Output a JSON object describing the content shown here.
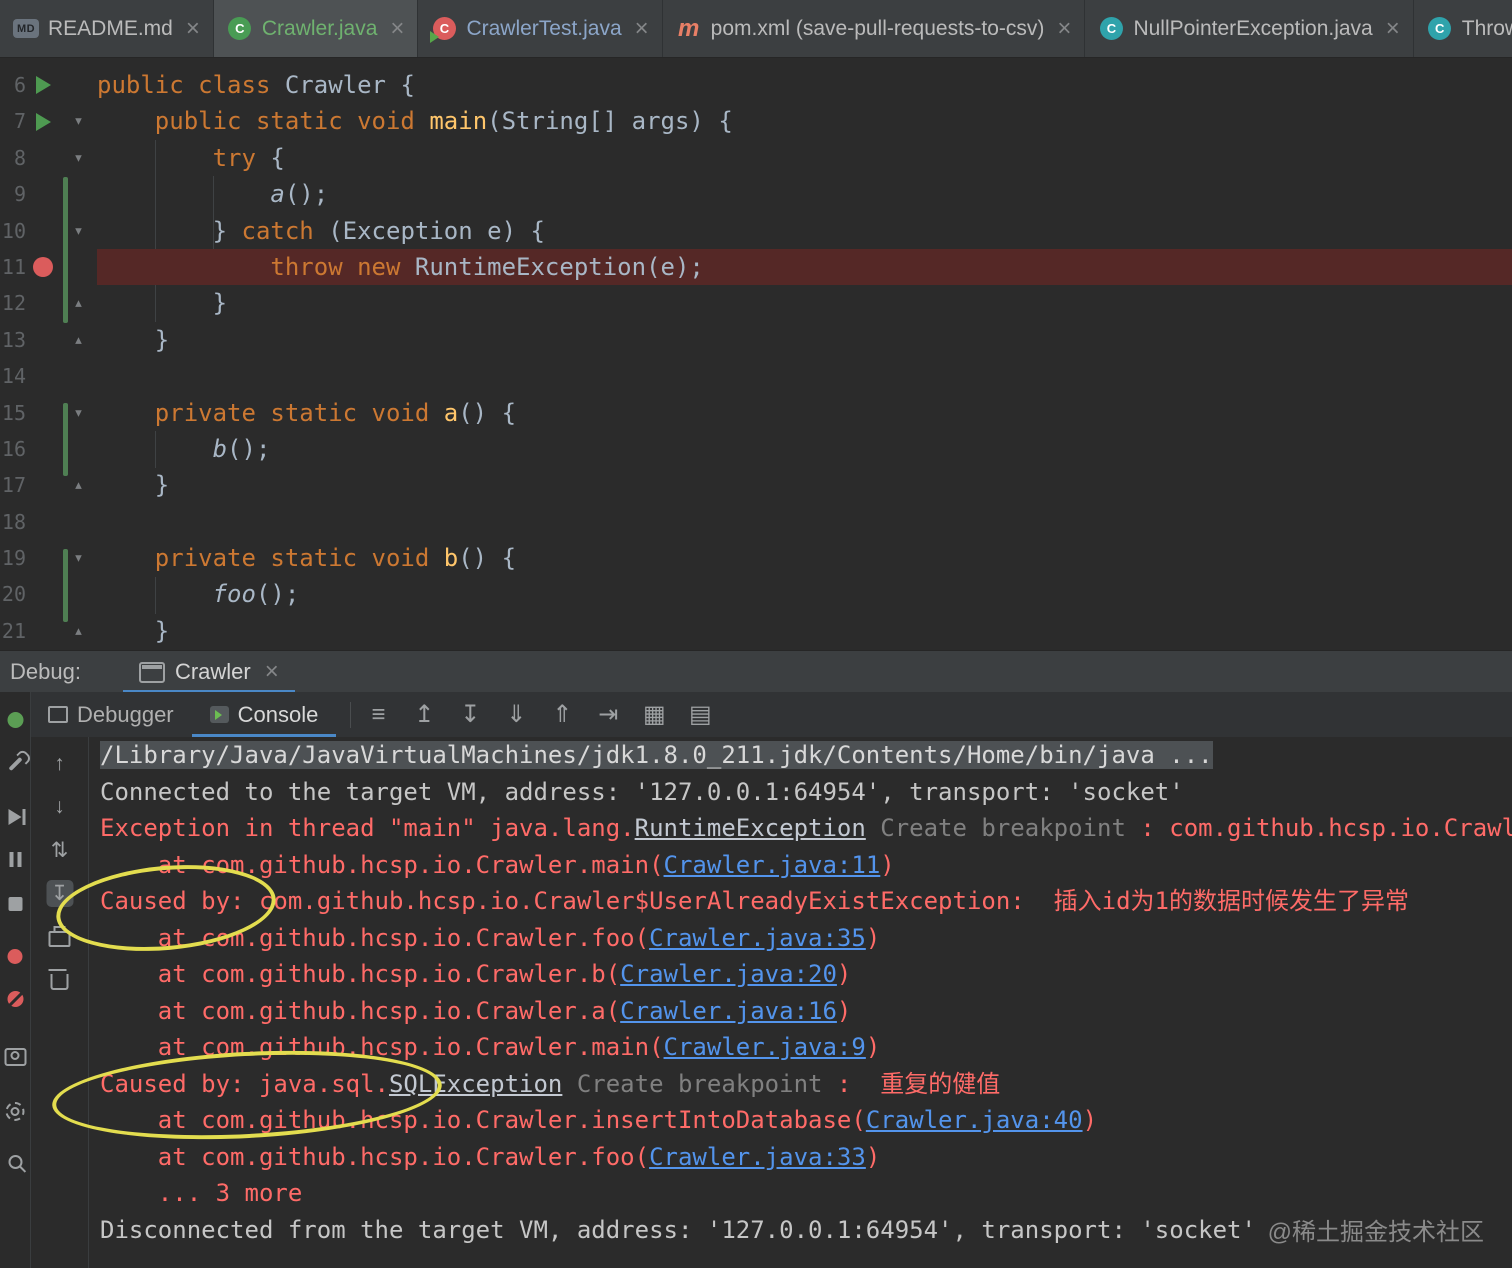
{
  "colors": {
    "accent": "#4a88c7",
    "error": "#ff6b68",
    "link": "#5394ec",
    "annotation_yellow": "#e3dd4f",
    "breakpoint_red": "#db5c5c",
    "keyword_orange": "#cc7832",
    "run_green": "#4e9a51"
  },
  "glyphs": {
    "close": "×",
    "fold_open": "▾",
    "fold_end": "▴"
  },
  "editor_tabs": [
    {
      "label": "README.md",
      "icon": "markdown-file-icon",
      "glyph": "MD",
      "color": "#bbbbbb",
      "active": false
    },
    {
      "label": "Crawler.java",
      "icon": "java-run-class-icon",
      "glyph": "C",
      "color": "#6fb26f",
      "active": true
    },
    {
      "label": "CrawlerTest.java",
      "icon": "java-test-class-icon",
      "glyph": "C",
      "color": "#8ca6c9",
      "active": false
    },
    {
      "label": "pom.xml (save-pull-requests-to-csv)",
      "icon": "maven-file-icon",
      "glyph": "m",
      "color": "#bbbbbb",
      "active": false
    },
    {
      "label": "NullPointerException.java",
      "icon": "java-class-icon",
      "glyph": "C",
      "color": "#bbbbbb",
      "active": false
    },
    {
      "label": "Throwable.java",
      "icon": "java-class-icon",
      "glyph": "C",
      "color": "#bbbbbb",
      "active": false
    }
  ],
  "editor": {
    "lines": [
      {
        "n": "6",
        "marker": "run",
        "fold": "",
        "hl": false,
        "tokens": [
          [
            "kw",
            "public class "
          ],
          [
            "pl",
            "Crawler {"
          ]
        ]
      },
      {
        "n": "7",
        "marker": "run",
        "fold": "open",
        "hl": false,
        "tokens": [
          [
            "pl",
            "    "
          ],
          [
            "kw",
            "public static void "
          ],
          [
            "fn",
            "main"
          ],
          [
            "pl",
            "(String[] args) {"
          ]
        ]
      },
      {
        "n": "8",
        "marker": "",
        "fold": "open",
        "hl": false,
        "tokens": [
          [
            "pl",
            "        "
          ],
          [
            "kw",
            "try"
          ],
          [
            "pl",
            " {"
          ]
        ]
      },
      {
        "n": "9",
        "marker": "",
        "fold": "",
        "hl": false,
        "tokens": [
          [
            "pl",
            "            "
          ],
          [
            "call",
            "a"
          ],
          [
            "pl",
            "();"
          ]
        ]
      },
      {
        "n": "10",
        "marker": "",
        "fold": "open",
        "hl": false,
        "tokens": [
          [
            "pl",
            "        } "
          ],
          [
            "kw",
            "catch"
          ],
          [
            "pl",
            " (Exception e) {"
          ]
        ]
      },
      {
        "n": "11",
        "marker": "bp",
        "fold": "",
        "hl": true,
        "tokens": [
          [
            "pl",
            "            "
          ],
          [
            "kw",
            "throw new "
          ],
          [
            "pl",
            "RuntimeException(e);"
          ]
        ]
      },
      {
        "n": "12",
        "marker": "",
        "fold": "end",
        "hl": false,
        "tokens": [
          [
            "pl",
            "        }"
          ]
        ]
      },
      {
        "n": "13",
        "marker": "",
        "fold": "end",
        "hl": false,
        "tokens": [
          [
            "pl",
            "    }"
          ]
        ]
      },
      {
        "n": "14",
        "marker": "",
        "fold": "",
        "hl": false,
        "tokens": []
      },
      {
        "n": "15",
        "marker": "",
        "fold": "open",
        "hl": false,
        "tokens": [
          [
            "pl",
            "    "
          ],
          [
            "kw",
            "private static void "
          ],
          [
            "fn",
            "a"
          ],
          [
            "pl",
            "() {"
          ]
        ]
      },
      {
        "n": "16",
        "marker": "",
        "fold": "",
        "hl": false,
        "tokens": [
          [
            "pl",
            "        "
          ],
          [
            "call",
            "b"
          ],
          [
            "pl",
            "();"
          ]
        ]
      },
      {
        "n": "17",
        "marker": "",
        "fold": "end",
        "hl": false,
        "tokens": [
          [
            "pl",
            "    }"
          ]
        ]
      },
      {
        "n": "18",
        "marker": "",
        "fold": "",
        "hl": false,
        "tokens": []
      },
      {
        "n": "19",
        "marker": "",
        "fold": "open",
        "hl": false,
        "tokens": [
          [
            "pl",
            "    "
          ],
          [
            "kw",
            "private static void "
          ],
          [
            "fn",
            "b"
          ],
          [
            "pl",
            "() {"
          ]
        ]
      },
      {
        "n": "20",
        "marker": "",
        "fold": "",
        "hl": false,
        "tokens": [
          [
            "pl",
            "        "
          ],
          [
            "call",
            "foo"
          ],
          [
            "pl",
            "();"
          ]
        ]
      },
      {
        "n": "21",
        "marker": "",
        "fold": "end",
        "hl": false,
        "tokens": [
          [
            "pl",
            "    }"
          ]
        ]
      }
    ]
  },
  "debug_header": {
    "label": "Debug:",
    "tab": "Crawler",
    "close": "×"
  },
  "debug_toolbar": {
    "tabs": [
      {
        "label": "Debugger",
        "icon": "debugger-frames-icon",
        "cls": "i-frames",
        "active": false
      },
      {
        "label": "Console",
        "icon": "console-icon",
        "cls": "i-console",
        "active": true
      }
    ],
    "icons": [
      {
        "name": "soft-wrap-icon",
        "glyph": "≡"
      },
      {
        "name": "scroll-up-icon",
        "glyph": "↥"
      },
      {
        "name": "scroll-down-icon",
        "glyph": "↧"
      },
      {
        "name": "move-down-icon",
        "glyph": "⇓"
      },
      {
        "name": "move-up-icon",
        "glyph": "⇑"
      },
      {
        "name": "jump-to-end-icon",
        "glyph": "⇥"
      },
      {
        "name": "restore-layout-icon",
        "glyph": "▦"
      },
      {
        "name": "console-settings-icon",
        "glyph": "▤"
      }
    ]
  },
  "left_strip1": [
    {
      "name": "debug-tool-icon",
      "kind": "css",
      "cls": "i-debug-green"
    },
    {
      "name": "wrench-icon",
      "kind": "css",
      "cls": "i-wrench"
    },
    {
      "name": "resume-icon",
      "kind": "css",
      "cls": "i-resume"
    },
    {
      "name": "pause-icon",
      "kind": "css",
      "cls": "i-pause"
    },
    {
      "name": "stop-icon",
      "kind": "css",
      "cls": "i-stop"
    },
    {
      "name": "view-breakpoints-icon",
      "kind": "css",
      "cls": "i-bpdot"
    },
    {
      "name": "mute-breakpoints-icon",
      "kind": "css",
      "cls": "i-mute"
    },
    {
      "name": "thread-dump-camera-icon",
      "kind": "css",
      "cls": "i-camera"
    },
    {
      "name": "settings-gear-icon",
      "kind": "css",
      "cls": "i-gear"
    },
    {
      "name": "pin-icon",
      "kind": "css",
      "cls": "i-pin"
    }
  ],
  "left_strip2": [
    {
      "name": "arrow-up-icon",
      "kind": "glyph",
      "glyph": "↑"
    },
    {
      "name": "arrow-down-icon",
      "kind": "glyph",
      "glyph": "↓"
    },
    {
      "name": "sort-arrows-icon",
      "kind": "glyph",
      "glyph": "⇅"
    },
    {
      "name": "scroll-to-end-icon",
      "kind": "glyph",
      "glyph": "↧",
      "toggled": true
    },
    {
      "name": "print-icon",
      "kind": "css",
      "cls": "i-printer"
    },
    {
      "name": "clear-trash-icon",
      "kind": "css",
      "cls": "i-trash"
    }
  ],
  "console": {
    "lines": [
      {
        "tokens": [
          [
            "sel",
            "/Library/Java/JavaVirtualMachines/jdk1.8.0_211.jdk/Contents/Home/bin/java ..."
          ]
        ]
      },
      {
        "tokens": [
          [
            "out",
            "Connected to the target VM, address: '127.0.0.1:64954', transport: 'socket'"
          ]
        ]
      },
      {
        "tokens": [
          [
            "err",
            "Exception in thread \"main\" java.lang."
          ],
          [
            "exlink",
            "RuntimeException"
          ],
          [
            "hint",
            " Create breakpoint"
          ],
          [
            "err",
            " : com.github.hcsp.io.Crawle"
          ]
        ]
      },
      {
        "tokens": [
          [
            "err",
            "    at com.github.hcsp.io.Crawler.main("
          ],
          [
            "linkfile",
            "Crawler.java:11"
          ],
          [
            "err",
            ")"
          ]
        ]
      },
      {
        "tokens": [
          [
            "err",
            "Caused by: com.github.hcsp.io.Crawler$UserAlreadyExistException:  插入id为1的数据时候发生了异常"
          ]
        ]
      },
      {
        "tokens": [
          [
            "err",
            "    at com.github.hcsp.io.Crawler.foo("
          ],
          [
            "linkfile",
            "Crawler.java:35"
          ],
          [
            "err",
            ")"
          ]
        ]
      },
      {
        "tokens": [
          [
            "err",
            "    at com.github.hcsp.io.Crawler.b("
          ],
          [
            "linkfile",
            "Crawler.java:20"
          ],
          [
            "err",
            ")"
          ]
        ]
      },
      {
        "tokens": [
          [
            "err",
            "    at com.github.hcsp.io.Crawler.a("
          ],
          [
            "linkfile",
            "Crawler.java:16"
          ],
          [
            "err",
            ")"
          ]
        ]
      },
      {
        "tokens": [
          [
            "err",
            "    at com.github.hcsp.io.Crawler.main("
          ],
          [
            "linkfile",
            "Crawler.java:9"
          ],
          [
            "err",
            ")"
          ]
        ]
      },
      {
        "tokens": [
          [
            "err",
            "Caused by: java.sql."
          ],
          [
            "exlink",
            "SQLException"
          ],
          [
            "hint",
            " Create breakpoint"
          ],
          [
            "err",
            " :  重复的健值"
          ]
        ]
      },
      {
        "tokens": [
          [
            "err",
            "    at com.github.hcsp.io.Crawler.insertIntoDatabase("
          ],
          [
            "linkfile",
            "Crawler.java:40"
          ],
          [
            "err",
            ")"
          ]
        ]
      },
      {
        "tokens": [
          [
            "err",
            "    at com.github.hcsp.io.Crawler.foo("
          ],
          [
            "linkfile",
            "Crawler.java:33"
          ],
          [
            "err",
            ")"
          ]
        ]
      },
      {
        "tokens": [
          [
            "err",
            "    ... 3 more"
          ]
        ]
      },
      {
        "tokens": [
          [
            "out",
            "Disconnected from the target VM, address: '127.0.0.1:64954', transport: 'socket'"
          ]
        ]
      }
    ]
  },
  "watermark": "@稀土掘金技术社区"
}
